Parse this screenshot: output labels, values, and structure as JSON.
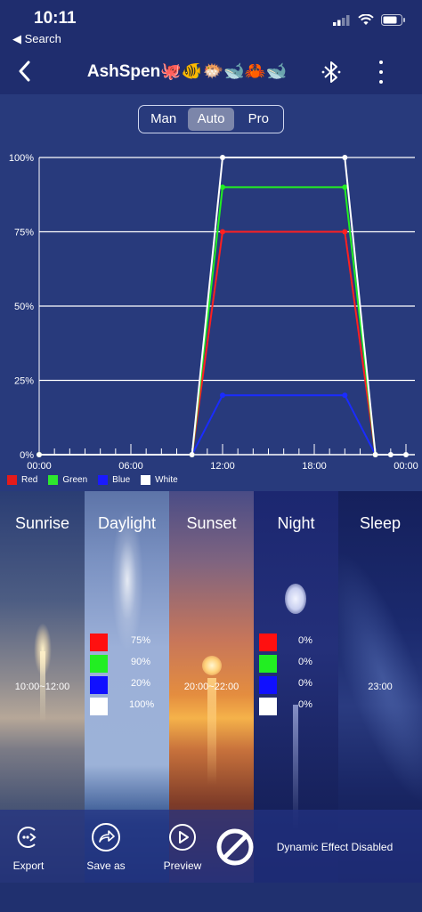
{
  "status": {
    "time": "10:11",
    "back_label": "◀ Search"
  },
  "nav": {
    "title": "AshSpen🐙🐠🐡🐋🦀🐋"
  },
  "modes": [
    {
      "label": "Man",
      "active": false
    },
    {
      "label": "Auto",
      "active": true
    },
    {
      "label": "Pro",
      "active": false
    }
  ],
  "chart_data": {
    "type": "line",
    "x_ticks": [
      "00:00",
      "06:00",
      "12:00",
      "18:00",
      "00:00"
    ],
    "y_ticks": [
      "0%",
      "25%",
      "50%",
      "75%",
      "100%"
    ],
    "ylim": [
      0,
      100
    ],
    "xlim": [
      0,
      24
    ],
    "series": [
      {
        "name": "Red",
        "color": "#ff2020",
        "points": [
          [
            0,
            0
          ],
          [
            10,
            0
          ],
          [
            12,
            75
          ],
          [
            20,
            75
          ],
          [
            22,
            0
          ]
        ]
      },
      {
        "name": "Green",
        "color": "#22ee22",
        "points": [
          [
            0,
            0
          ],
          [
            10,
            0
          ],
          [
            12,
            90
          ],
          [
            20,
            90
          ],
          [
            22,
            0
          ]
        ]
      },
      {
        "name": "Blue",
        "color": "#1a2cff",
        "points": [
          [
            0,
            0
          ],
          [
            10,
            0
          ],
          [
            12,
            20
          ],
          [
            20,
            20
          ],
          [
            22,
            0
          ]
        ]
      },
      {
        "name": "White",
        "color": "#ffffff",
        "points": [
          [
            0,
            0
          ],
          [
            10,
            0
          ],
          [
            12,
            100
          ],
          [
            20,
            100
          ],
          [
            22,
            0
          ],
          [
            23,
            0
          ],
          [
            24,
            0
          ]
        ]
      }
    ],
    "grid": true,
    "legend": "bottom-left"
  },
  "legend": [
    {
      "label": "Red",
      "color": "#e41b1b"
    },
    {
      "label": "Green",
      "color": "#2ee82e"
    },
    {
      "label": "Blue",
      "color": "#1a1aff"
    },
    {
      "label": "White",
      "color": "#ffffff"
    }
  ],
  "panels": [
    {
      "title": "Sunrise",
      "time": "10:00~12:00",
      "channels": []
    },
    {
      "title": "Daylight",
      "time": "",
      "channels": [
        {
          "color": "#ff1010",
          "value": "75%"
        },
        {
          "color": "#22ee22",
          "value": "90%"
        },
        {
          "color": "#1010ff",
          "value": "20%"
        },
        {
          "color": "#ffffff",
          "value": "100%"
        }
      ]
    },
    {
      "title": "Sunset",
      "time": "20:00~22:00",
      "channels": []
    },
    {
      "title": "Night",
      "time": "",
      "channels": [
        {
          "color": "#ff1010",
          "value": "0%"
        },
        {
          "color": "#22ee22",
          "value": "0%"
        },
        {
          "color": "#1010ff",
          "value": "0%"
        },
        {
          "color": "#ffffff",
          "value": "0%"
        }
      ]
    },
    {
      "title": "Sleep",
      "time": "23:00",
      "channels": []
    }
  ],
  "toolbar": {
    "export": "Export",
    "save_as": "Save as",
    "preview": "Preview",
    "dynamic_status": "Dynamic Effect Disabled"
  }
}
